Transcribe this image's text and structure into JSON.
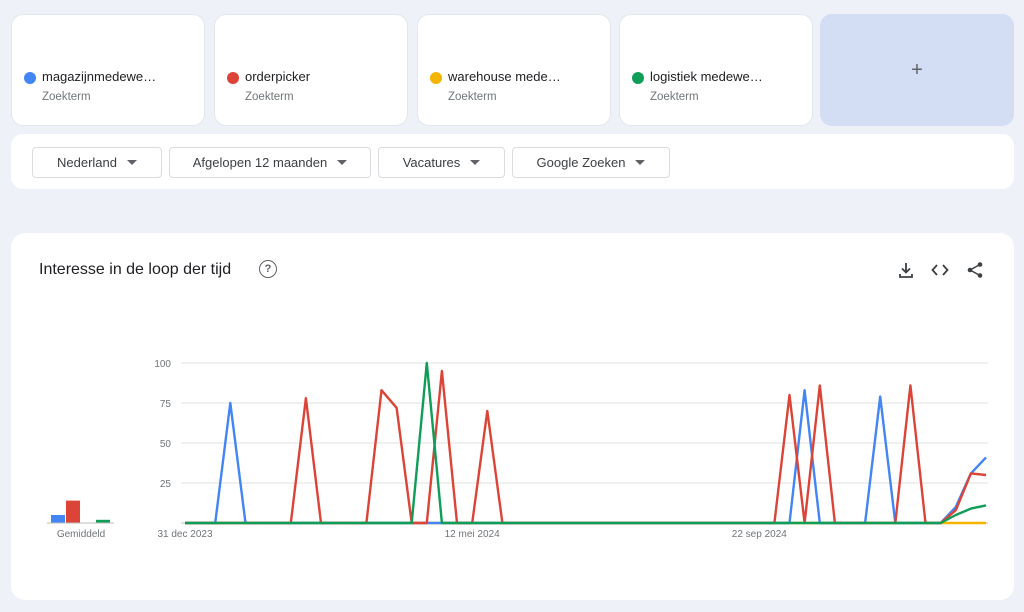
{
  "terms": [
    {
      "label": "magazijnmedewe…",
      "sub": "Zoekterm",
      "color": "#4285f4"
    },
    {
      "label": "orderpicker",
      "sub": "Zoekterm",
      "color": "#db4437"
    },
    {
      "label": "warehouse mede…",
      "sub": "Zoekterm",
      "color": "#f4b400"
    },
    {
      "label": "logistiek medewe…",
      "sub": "Zoekterm",
      "color": "#0f9d58"
    }
  ],
  "add_label": "+",
  "filters": {
    "region": "Nederland",
    "period": "Afgelopen 12 maanden",
    "category": "Vacatures",
    "source": "Google Zoeken"
  },
  "panel": {
    "title": "Interesse in de loop der tijd",
    "help": "?"
  },
  "chart_data": {
    "type": "line",
    "ylim": [
      0,
      100
    ],
    "yticks": [
      25,
      50,
      75,
      100
    ],
    "grid": true,
    "average_label": "Gemiddeld",
    "averages": [
      5,
      14,
      0,
      2
    ],
    "x_labels": [
      {
        "label": "31 dec 2023",
        "week": 0
      },
      {
        "label": "12 mei 2024",
        "week": 19
      },
      {
        "label": "22 sep 2024",
        "week": 38
      }
    ],
    "series": [
      {
        "color": "#4285f4",
        "values": [
          0,
          0,
          0,
          75,
          0,
          0,
          0,
          0,
          0,
          0,
          0,
          0,
          0,
          0,
          0,
          0,
          0,
          0,
          0,
          0,
          0,
          0,
          0,
          0,
          0,
          0,
          0,
          0,
          0,
          0,
          0,
          0,
          0,
          0,
          0,
          0,
          0,
          0,
          0,
          0,
          0,
          83,
          0,
          0,
          0,
          0,
          79,
          0,
          0,
          0,
          0,
          10,
          31,
          41
        ]
      },
      {
        "color": "#db4437",
        "values": [
          0,
          0,
          0,
          0,
          0,
          0,
          0,
          0,
          78,
          0,
          0,
          0,
          0,
          83,
          72,
          0,
          0,
          95,
          0,
          0,
          70,
          0,
          0,
          0,
          0,
          0,
          0,
          0,
          0,
          0,
          0,
          0,
          0,
          0,
          0,
          0,
          0,
          0,
          0,
          0,
          80,
          0,
          86,
          0,
          0,
          0,
          0,
          0,
          86,
          0,
          0,
          8,
          31,
          30
        ]
      },
      {
        "color": "#f4b400",
        "values": [
          0,
          0,
          0,
          0,
          0,
          0,
          0,
          0,
          0,
          0,
          0,
          0,
          0,
          0,
          0,
          0,
          0,
          0,
          0,
          0,
          0,
          0,
          0,
          0,
          0,
          0,
          0,
          0,
          0,
          0,
          0,
          0,
          0,
          0,
          0,
          0,
          0,
          0,
          0,
          0,
          0,
          0,
          0,
          0,
          0,
          0,
          0,
          0,
          0,
          0,
          0,
          0,
          0,
          0
        ]
      },
      {
        "color": "#0f9d58",
        "values": [
          0,
          0,
          0,
          0,
          0,
          0,
          0,
          0,
          0,
          0,
          0,
          0,
          0,
          0,
          0,
          0,
          100,
          0,
          0,
          0,
          0,
          0,
          0,
          0,
          0,
          0,
          0,
          0,
          0,
          0,
          0,
          0,
          0,
          0,
          0,
          0,
          0,
          0,
          0,
          0,
          0,
          0,
          0,
          0,
          0,
          0,
          0,
          0,
          0,
          0,
          0,
          5,
          9,
          11
        ]
      }
    ]
  }
}
